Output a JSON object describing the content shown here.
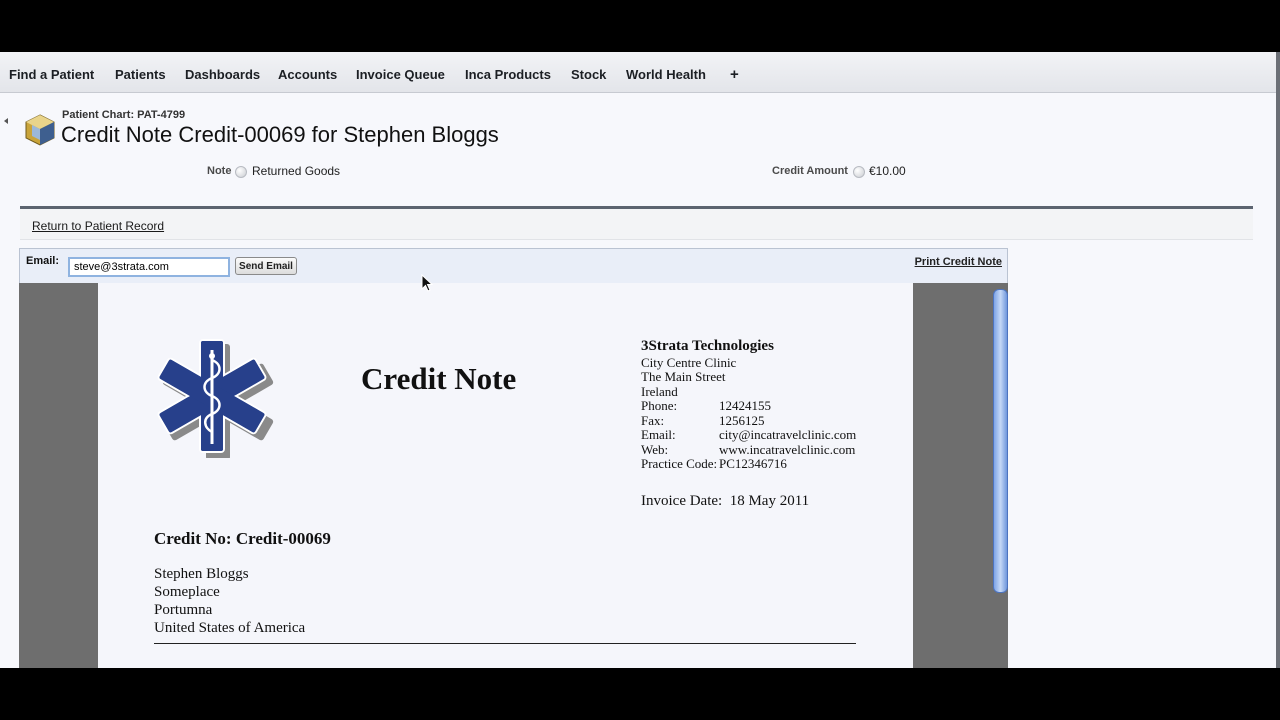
{
  "nav": {
    "tabs": [
      "Find a Patient",
      "Patients",
      "Dashboards",
      "Accounts",
      "Invoice Queue",
      "Inca Products",
      "Stock",
      "World Health"
    ],
    "add_tab_label": "+"
  },
  "header": {
    "breadcrumb": "Patient Chart: PAT-4799",
    "title": "Credit Note Credit-00069 for Stephen Bloggs",
    "fields": {
      "note_label": "Note",
      "note_value": "Returned Goods",
      "credit_amount_label": "Credit Amount",
      "credit_amount_value": "€10.00"
    }
  },
  "return_link": "Return to Patient Record",
  "email_panel": {
    "label": "Email:",
    "email_value": "steve@3strata.com",
    "send_button": "Send Email",
    "print_link": "Print Credit Note"
  },
  "document": {
    "title": "Credit Note",
    "company": {
      "name": "3Strata Technologies",
      "address_lines": [
        "City Centre Clinic",
        "The Main Street",
        "Ireland"
      ],
      "contacts": [
        {
          "label": "Phone:",
          "value": "12424155"
        },
        {
          "label": "Fax:",
          "value": "1256125"
        },
        {
          "label": "Email:",
          "value": "city@incatravelclinic.com"
        },
        {
          "label": "Web:",
          "value": "www.incatravelclinic.com"
        },
        {
          "label": "Practice Code:",
          "value": "PC12346716"
        }
      ]
    },
    "invoice_date": "Invoice Date:  18 May 2011",
    "credit_no": "Credit No: Credit-00069",
    "recipient_lines": [
      "Stephen Bloggs",
      "Someplace",
      "Portumna",
      "United States of America"
    ]
  },
  "colors": {
    "logo_blue": "#27408b",
    "email_panel_bg": "#e9eef8",
    "return_bar_rule": "#5c6470"
  }
}
